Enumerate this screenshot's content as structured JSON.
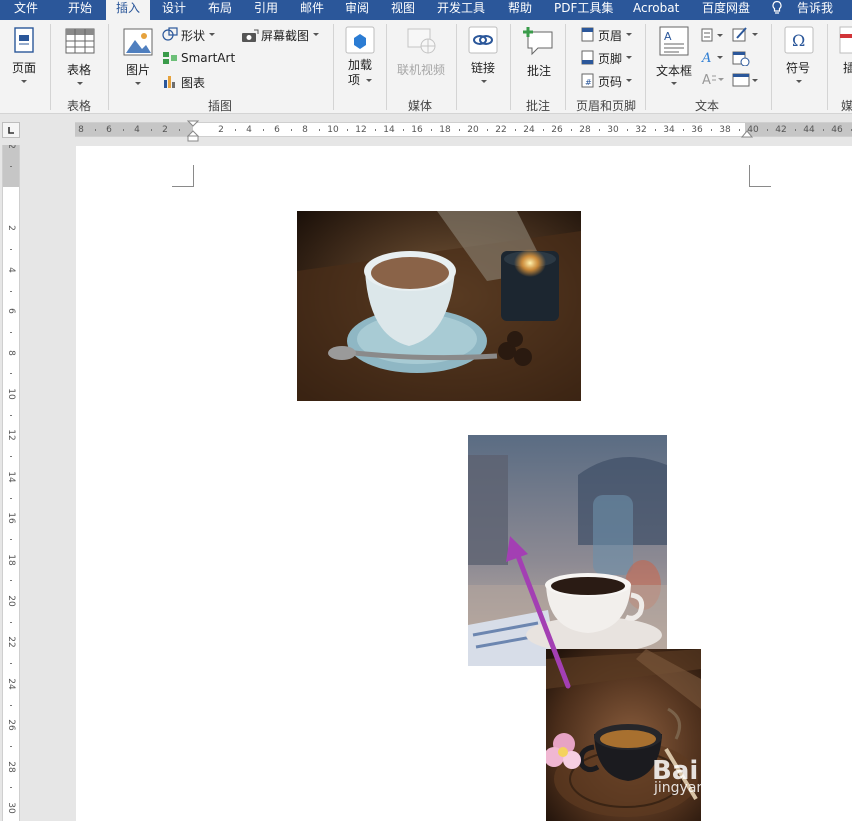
{
  "menu_tabs": [
    "文件",
    "开始",
    "插入",
    "设计",
    "布局",
    "引用",
    "邮件",
    "审阅",
    "视图",
    "开发工具",
    "帮助",
    "PDF工具集",
    "Acrobat",
    "百度网盘",
    "告诉我"
  ],
  "active_tab": "插入",
  "ribbon": {
    "pages": {
      "label": "页面",
      "group": ""
    },
    "tables": {
      "label": "表格",
      "group": "表格"
    },
    "illustrations": {
      "group": "插图",
      "picture": "图片",
      "shapes": "形状",
      "smartart": "SmartArt",
      "chart": "图表",
      "screenshot": "屏幕截图"
    },
    "addins": {
      "label": "加载\n项"
    },
    "media": {
      "group": "媒体",
      "online_video": "联机视频"
    },
    "links": {
      "label": "链接"
    },
    "comments": {
      "group": "批注",
      "comment": "批注"
    },
    "header_footer": {
      "group": "页眉和页脚",
      "header": "页眉",
      "footer": "页脚",
      "page_number": "页码"
    },
    "text": {
      "group": "文本",
      "textbox": "文本框"
    },
    "symbols": {
      "label": "符号"
    },
    "partial": {
      "insert": "插",
      "media": "媒"
    }
  },
  "ruler": {
    "h_labels": [
      "8",
      "6",
      "4",
      "2",
      "2",
      "4",
      "6",
      "8",
      "10",
      "12",
      "14",
      "16",
      "18",
      "20",
      "22",
      "24",
      "26",
      "28",
      "30",
      "32",
      "34",
      "36",
      "38",
      "40",
      "42",
      "44",
      "46"
    ],
    "v_labels": [
      "2",
      "2",
      "4",
      "6",
      "8",
      "10",
      "12",
      "14",
      "16",
      "18",
      "20",
      "22",
      "24",
      "26",
      "28",
      "30"
    ]
  },
  "watermark": {
    "logo": "Bai du 经验",
    "url": "jingyan.baidu.com"
  },
  "colors": {
    "accent": "#2b579a",
    "arrow": "#a33fb3"
  }
}
